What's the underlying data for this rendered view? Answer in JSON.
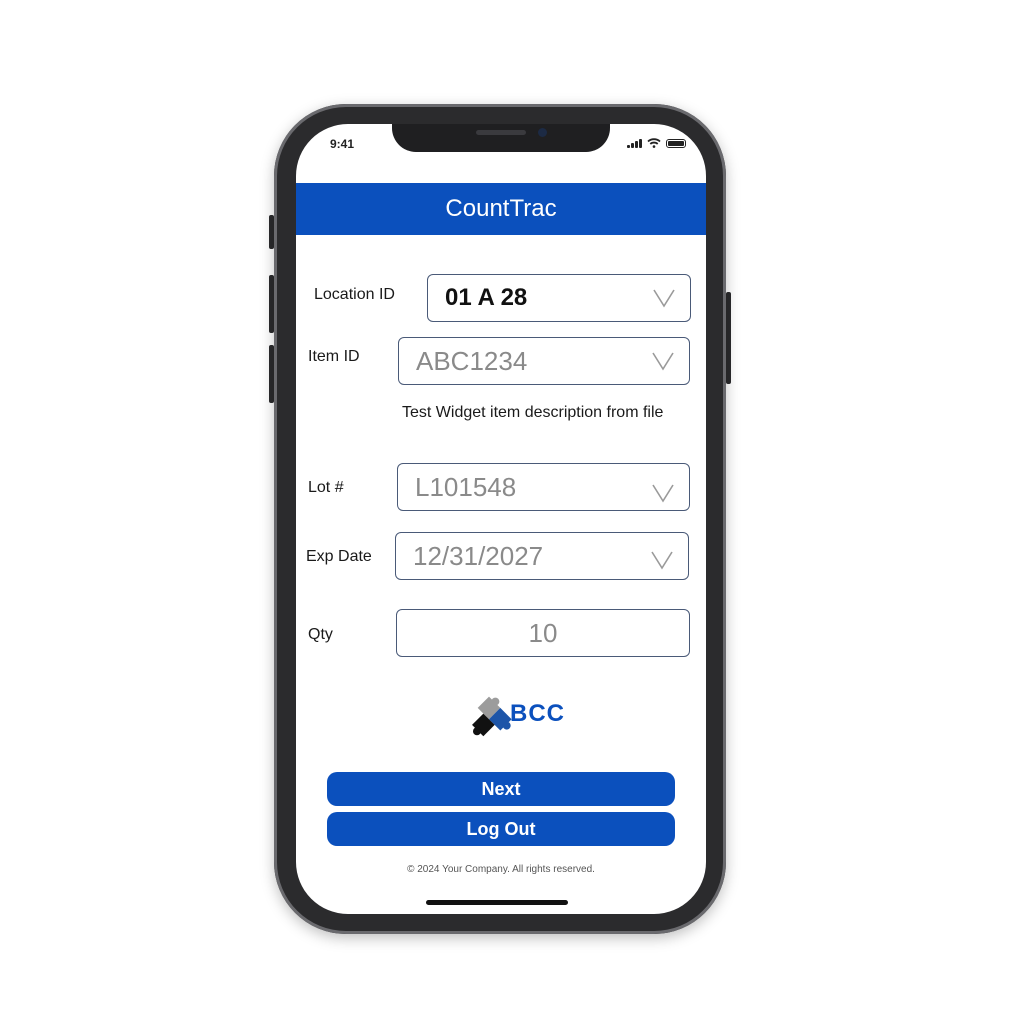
{
  "status": {
    "time": "9:41"
  },
  "app": {
    "title": "CountTrac"
  },
  "form": {
    "location": {
      "label": "Location ID",
      "value": "01 A 28"
    },
    "item": {
      "label": "Item ID",
      "value": "ABC1234",
      "description": "Test Widget item description from file"
    },
    "lot": {
      "label": "Lot #",
      "value": "L101548"
    },
    "exp_date": {
      "label": "Exp Date",
      "value": "12/31/2027"
    },
    "qty": {
      "label": "Qty",
      "value": "10"
    }
  },
  "logo": {
    "text": "BCC",
    "icon": "puzzle-pieces-icon"
  },
  "actions": {
    "next_label": "Next",
    "logout_label": "Log Out"
  },
  "footer": {
    "copyright": "© 2024 Your Company. All rights reserved."
  },
  "colors": {
    "primary": "#0b50bd",
    "field_border": "#4a5a78",
    "value_gray": "#8a8a8a"
  }
}
